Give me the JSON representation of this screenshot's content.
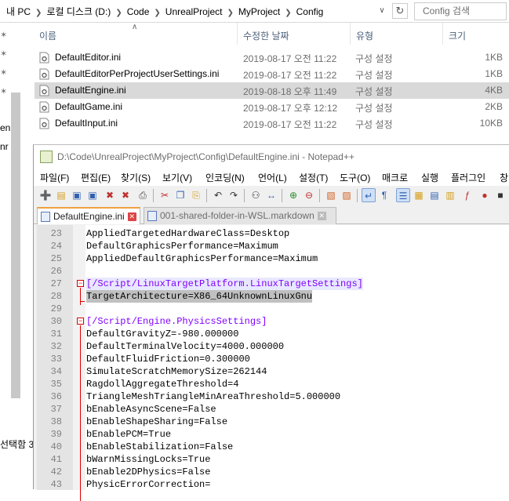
{
  "explorer": {
    "breadcrumb": [
      "내 PC",
      "로컬 디스크 (D:)",
      "Code",
      "UnrealProject",
      "MyProject",
      "Config"
    ],
    "search_placeholder": "Config 검색",
    "columns": {
      "name": "이름",
      "date": "수정한 날짜",
      "type": "유형",
      "size": "크기"
    },
    "files": [
      {
        "name": "DefaultEditor.ini",
        "date": "2019-08-17 오전 11:22",
        "type": "구성 설정",
        "size": "1KB"
      },
      {
        "name": "DefaultEditorPerProjectUserSettings.ini",
        "date": "2019-08-17 오전 11:22",
        "type": "구성 설정",
        "size": "1KB"
      },
      {
        "name": "DefaultEngine.ini",
        "date": "2019-08-18 오후 11:49",
        "type": "구성 설정",
        "size": "4KB"
      },
      {
        "name": "DefaultGame.ini",
        "date": "2019-08-17 오후 12:12",
        "type": "구성 설정",
        "size": "2KB"
      },
      {
        "name": "DefaultInput.ini",
        "date": "2019-08-17 오전 11:22",
        "type": "구성 설정",
        "size": "10KB"
      }
    ],
    "nav_fragments": [
      "en",
      "nr"
    ],
    "status_text": "선택함 3."
  },
  "notepad": {
    "title": "D:\\Code\\UnrealProject\\MyProject\\Config\\DefaultEngine.ini - Notepad++",
    "menu": [
      "파일(F)",
      "편집(E)",
      "찾기(S)",
      "보기(V)",
      "인코딩(N)",
      "언어(L)",
      "설정(T)",
      "도구(O)",
      "매크로",
      "실행",
      "플러그인",
      "창"
    ],
    "tabs": [
      "DefaultEngine.ini",
      "001-shared-folder-in-WSL.markdown"
    ],
    "lines": [
      {
        "n": "23",
        "key": "AppliedTargetedHardwareClass",
        "val": "Desktop"
      },
      {
        "n": "24",
        "key": "DefaultGraphicsPerformance",
        "val": "Maximum"
      },
      {
        "n": "25",
        "key": "AppliedDefaultGraphicsPerformance",
        "val": "Maximum"
      },
      {
        "n": "26",
        "text": ""
      },
      {
        "n": "27",
        "section": "[/Script/LinuxTargetPlatform.LinuxTargetSettings]"
      },
      {
        "n": "28",
        "key": "TargetArchitecture",
        "val": "X86_64UnknownLinuxGnu"
      },
      {
        "n": "29",
        "text": ""
      },
      {
        "n": "30",
        "section": "[/Script/Engine.PhysicsSettings]"
      },
      {
        "n": "31",
        "key": "DefaultGravityZ",
        "val": "-980.000000"
      },
      {
        "n": "32",
        "key": "DefaultTerminalVelocity",
        "val": "4000.000000"
      },
      {
        "n": "33",
        "key": "DefaultFluidFriction",
        "val": "0.300000"
      },
      {
        "n": "34",
        "key": "SimulateScratchMemorySize",
        "val": "262144"
      },
      {
        "n": "35",
        "key": "RagdollAggregateThreshold",
        "val": "4"
      },
      {
        "n": "36",
        "key": "TriangleMeshTriangleMinAreaThreshold",
        "val": "5.000000"
      },
      {
        "n": "37",
        "key": "bEnableAsyncScene",
        "val": "False"
      },
      {
        "n": "38",
        "key": "bEnableShapeSharing",
        "val": "False"
      },
      {
        "n": "39",
        "key": "bEnablePCM",
        "val": "True"
      },
      {
        "n": "40",
        "key": "bEnableStabilization",
        "val": "False"
      },
      {
        "n": "41",
        "key": "bWarnMissingLocks",
        "val": "True"
      },
      {
        "n": "42",
        "key": "bEnable2DPhysics",
        "val": "False"
      },
      {
        "n": "43",
        "key": "PhysicErrorCorrection",
        "val": ""
      }
    ]
  }
}
